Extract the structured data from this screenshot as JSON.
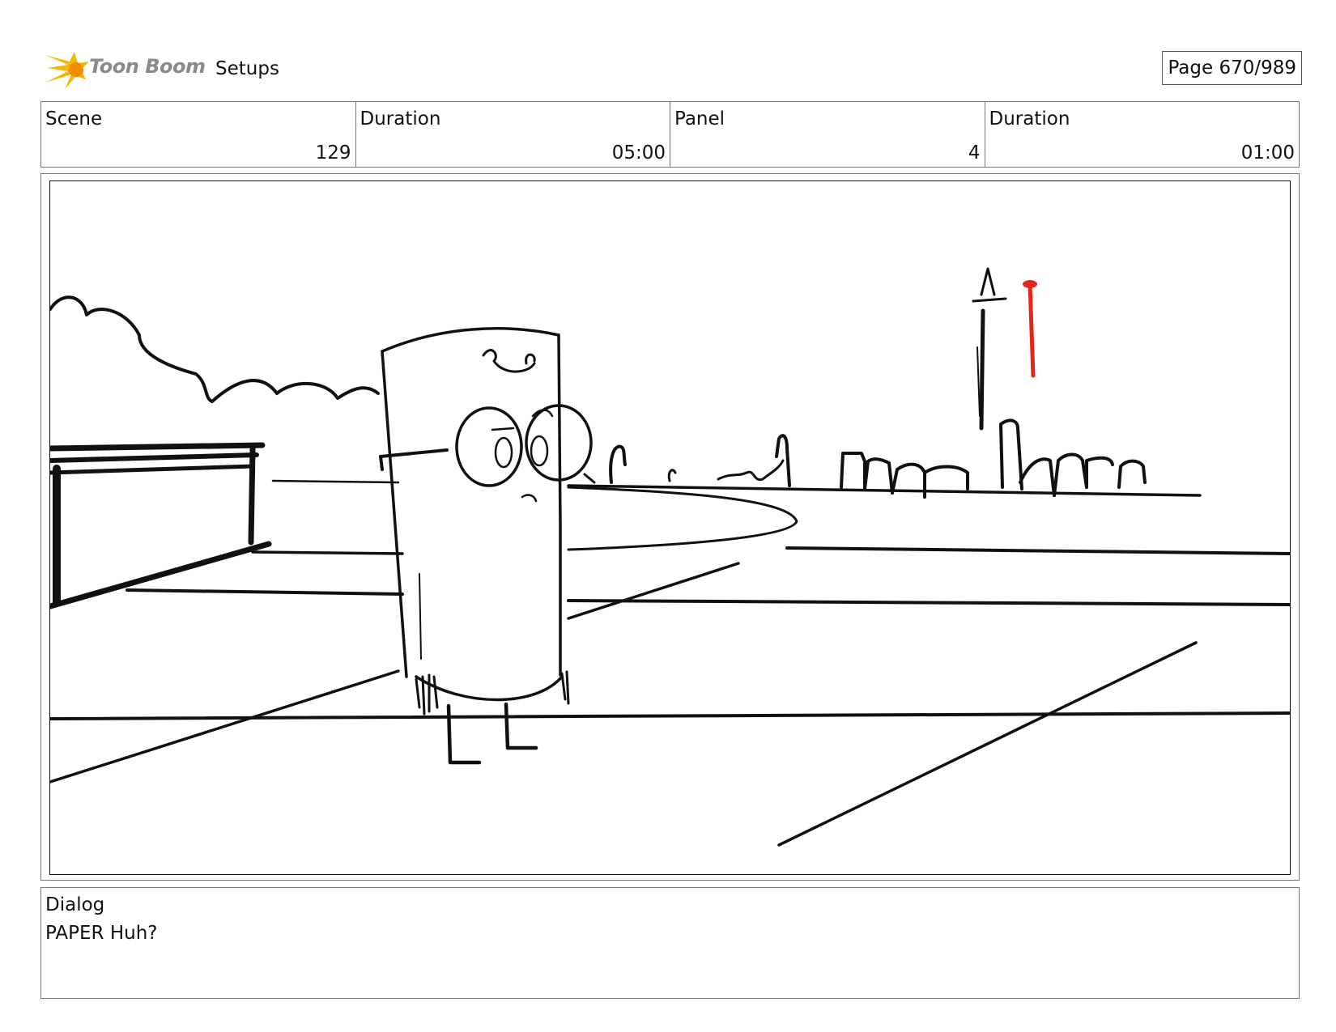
{
  "header": {
    "logo_text": "Toon Boom",
    "section_title": "Setups",
    "page_label": "Page 670/989"
  },
  "info": {
    "scene_label": "Scene",
    "scene_value": "129",
    "scene_duration_label": "Duration",
    "scene_duration_value": "05:00",
    "panel_label": "Panel",
    "panel_value": "4",
    "panel_duration_label": "Duration",
    "panel_duration_value": "01:00"
  },
  "dialog": {
    "label": "Dialog",
    "text": "PAPER Huh?"
  },
  "colors": {
    "logo_yellow": "#f5b800",
    "logo_orange": "#f08c00",
    "sketch_red": "#e3261e"
  }
}
